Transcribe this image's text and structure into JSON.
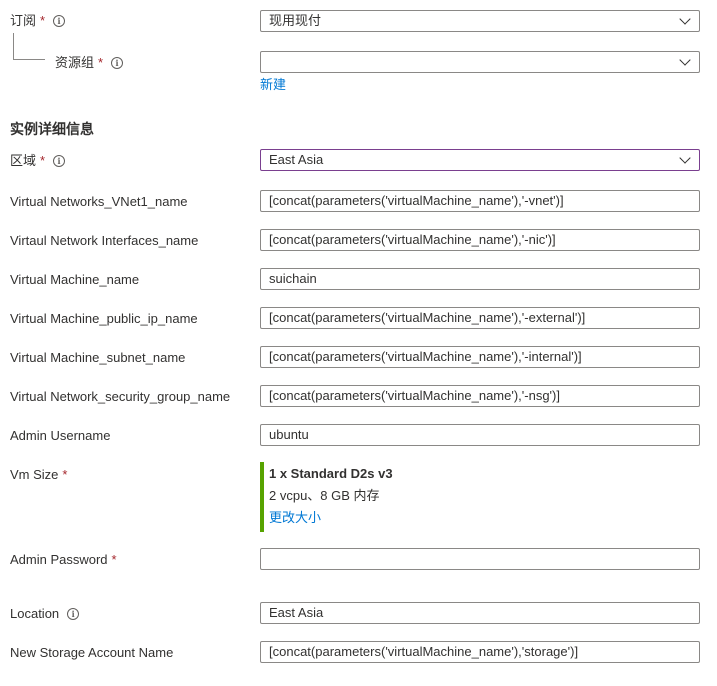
{
  "subscription": {
    "label": "订阅",
    "required": "*",
    "value": "现用现付"
  },
  "resource_group": {
    "label": "资源组",
    "required": "*",
    "value": "",
    "create_new_link": "新建"
  },
  "section_title": "实例详细信息",
  "region": {
    "label": "区域",
    "required": "*",
    "value": "East Asia"
  },
  "fields": [
    {
      "label": "Virtual Networks_VNet1_name",
      "value": "[concat(parameters('virtualMachine_name'),'-vnet')]"
    },
    {
      "label": "Virtaul Network Interfaces_name",
      "value": "[concat(parameters('virtualMachine_name'),'-nic')]"
    },
    {
      "label": "Virtual Machine_name",
      "value": "suichain"
    },
    {
      "label": "Virtual Machine_public_ip_name",
      "value": "[concat(parameters('virtualMachine_name'),'-external')]"
    },
    {
      "label": "Virtual Machine_subnet_name",
      "value": "[concat(parameters('virtualMachine_name'),'-internal')]"
    },
    {
      "label": "Virtual Network_security_group_name",
      "value": "[concat(parameters('virtualMachine_name'),'-nsg')]"
    },
    {
      "label": "Admin Username",
      "value": "ubuntu"
    }
  ],
  "vm_size": {
    "label": "Vm Size",
    "required": "*",
    "title": "1 x Standard D2s v3",
    "spec": "2 vcpu、8 GB 内存",
    "change_link": "更改大小",
    "accent_color": "#57a300"
  },
  "admin_password": {
    "label": "Admin Password",
    "required": "*",
    "value": ""
  },
  "location": {
    "label": "Location",
    "value": "East Asia"
  },
  "storage_account": {
    "label": "New Storage Account Name",
    "value": "[concat(parameters('virtualMachine_name'),'storage')]"
  },
  "icons": {
    "info": "info-icon",
    "dropdown": "chevron-down-icon"
  },
  "colors": {
    "link": "#0078d4",
    "required": "#a4262c",
    "focus_border": "#7a3f8f",
    "border": "#8a8886"
  }
}
